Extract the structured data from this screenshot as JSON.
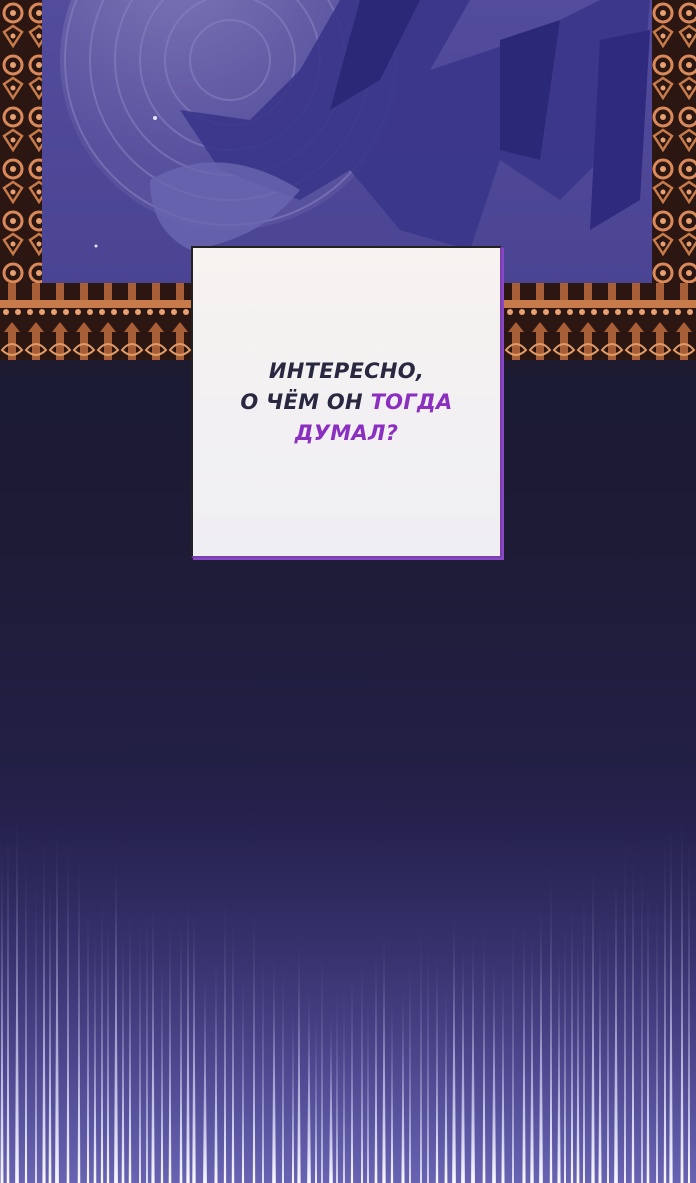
{
  "caption": {
    "line1": "ИНТЕРЕСНО,",
    "line2_a": "О ЧЁМ ОН ",
    "line2_b": "ТОГДА",
    "line3": "ДУМАЛ?"
  },
  "colors": {
    "background": "#1c1a33",
    "panel_blue": "#5b53a8",
    "frame_copper": "#c77a4a",
    "caption_text": "#2a2740",
    "caption_accent": "#8a2fc0"
  }
}
